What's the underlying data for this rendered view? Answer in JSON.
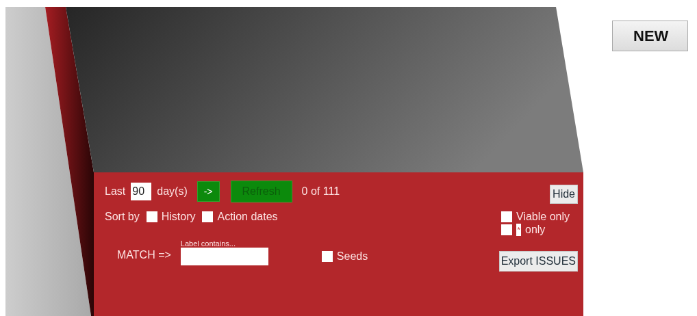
{
  "new_button": "NEW",
  "days": {
    "prefix": "Last",
    "value": "90",
    "suffix": "day(s)"
  },
  "go_button": "->",
  "refresh_button": "Refresh",
  "count": "0 of 111",
  "hide_button": "Hide",
  "sort": {
    "label": "Sort by",
    "options": [
      {
        "label": "History",
        "checked": false
      },
      {
        "label": "Action dates",
        "checked": false
      }
    ]
  },
  "filters": [
    {
      "kind": "plain",
      "label": "Viable only",
      "checked": false
    },
    {
      "kind": "marked",
      "marker": "*",
      "label": "only",
      "checked": false
    }
  ],
  "match": {
    "label": "MATCH =>",
    "field_label": "Label contains..."
  },
  "seeds": {
    "label": "Seeds",
    "checked": false
  },
  "export_button": "Export ISSUES"
}
